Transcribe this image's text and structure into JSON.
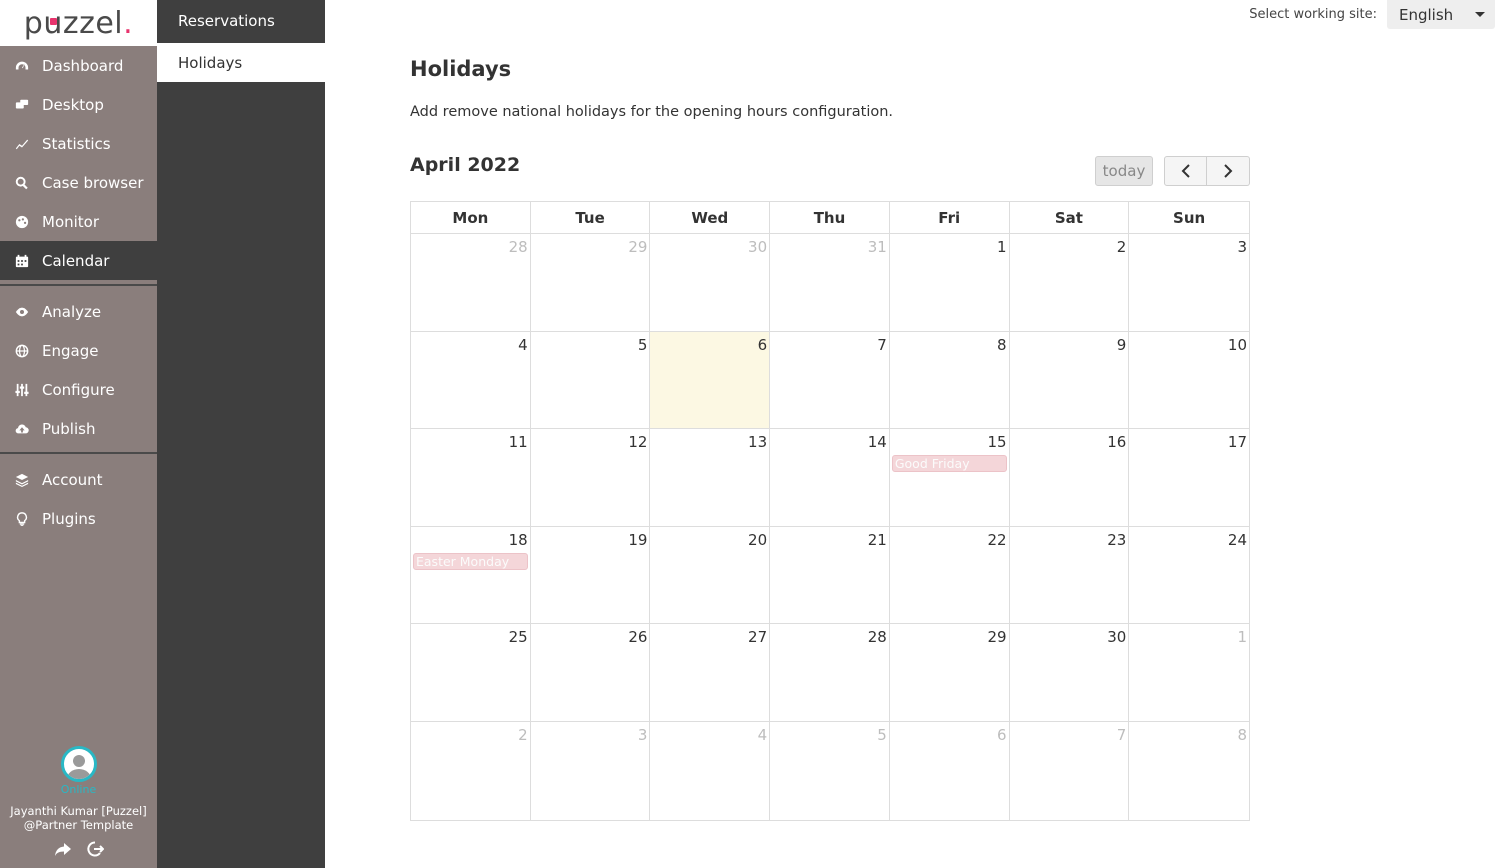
{
  "logo": {
    "text_pre": "p",
    "text_u": "u",
    "text_post": "zzel",
    "text_dot": "."
  },
  "nav": {
    "group1": [
      {
        "label": "Dashboard",
        "icon": "dashboard-icon"
      },
      {
        "label": "Desktop",
        "icon": "desktop-icon"
      },
      {
        "label": "Statistics",
        "icon": "statistics-icon"
      },
      {
        "label": "Case browser",
        "icon": "search-icon"
      },
      {
        "label": "Monitor",
        "icon": "monitor-icon"
      },
      {
        "label": "Calendar",
        "icon": "calendar-icon",
        "active": true
      }
    ],
    "group2": [
      {
        "label": "Analyze",
        "icon": "eye-icon"
      },
      {
        "label": "Engage",
        "icon": "globe-icon"
      },
      {
        "label": "Configure",
        "icon": "sliders-icon"
      },
      {
        "label": "Publish",
        "icon": "cloud-upload-icon"
      }
    ],
    "group3": [
      {
        "label": "Account",
        "icon": "layers-icon"
      },
      {
        "label": "Plugins",
        "icon": "lightbulb-icon"
      }
    ]
  },
  "user": {
    "status": "Online",
    "name": "Jayanthi Kumar [Puzzel]",
    "org": "@Partner Template"
  },
  "subnav": {
    "items": [
      {
        "label": "Reservations"
      },
      {
        "label": "Holidays",
        "active": true
      }
    ]
  },
  "site": {
    "label": "Select working site:",
    "value": "English"
  },
  "main": {
    "title": "Holidays",
    "description": "Add remove national holidays for the opening hours configuration.",
    "calendar_title": "April 2022",
    "today_label": "today"
  },
  "calendar": {
    "weekdays": [
      "Mon",
      "Tue",
      "Wed",
      "Thu",
      "Fri",
      "Sat",
      "Sun"
    ],
    "weeks": [
      [
        {
          "d": "28",
          "other": true
        },
        {
          "d": "29",
          "other": true
        },
        {
          "d": "30",
          "other": true
        },
        {
          "d": "31",
          "other": true
        },
        {
          "d": "1"
        },
        {
          "d": "2"
        },
        {
          "d": "3"
        }
      ],
      [
        {
          "d": "4"
        },
        {
          "d": "5"
        },
        {
          "d": "6",
          "today": true
        },
        {
          "d": "7"
        },
        {
          "d": "8"
        },
        {
          "d": "9"
        },
        {
          "d": "10"
        }
      ],
      [
        {
          "d": "11"
        },
        {
          "d": "12"
        },
        {
          "d": "13"
        },
        {
          "d": "14"
        },
        {
          "d": "15",
          "event": "Good Friday"
        },
        {
          "d": "16"
        },
        {
          "d": "17"
        }
      ],
      [
        {
          "d": "18",
          "event": "Easter Monday"
        },
        {
          "d": "19"
        },
        {
          "d": "20"
        },
        {
          "d": "21"
        },
        {
          "d": "22"
        },
        {
          "d": "23"
        },
        {
          "d": "24"
        }
      ],
      [
        {
          "d": "25"
        },
        {
          "d": "26"
        },
        {
          "d": "27"
        },
        {
          "d": "28"
        },
        {
          "d": "29"
        },
        {
          "d": "30"
        },
        {
          "d": "1",
          "other": true
        }
      ],
      [
        {
          "d": "2",
          "other": true
        },
        {
          "d": "3",
          "other": true
        },
        {
          "d": "4",
          "other": true
        },
        {
          "d": "5",
          "other": true
        },
        {
          "d": "6",
          "other": true
        },
        {
          "d": "7",
          "other": true
        },
        {
          "d": "8",
          "other": true
        }
      ]
    ]
  },
  "colors": {
    "nav_bg": "#8a7e7c",
    "subnav_bg": "#3f3f3f",
    "brand_accent": "#e8336d",
    "online": "#29b8c5",
    "today_bg": "#fcf8e3",
    "event_bg": "#f4d6d9"
  }
}
